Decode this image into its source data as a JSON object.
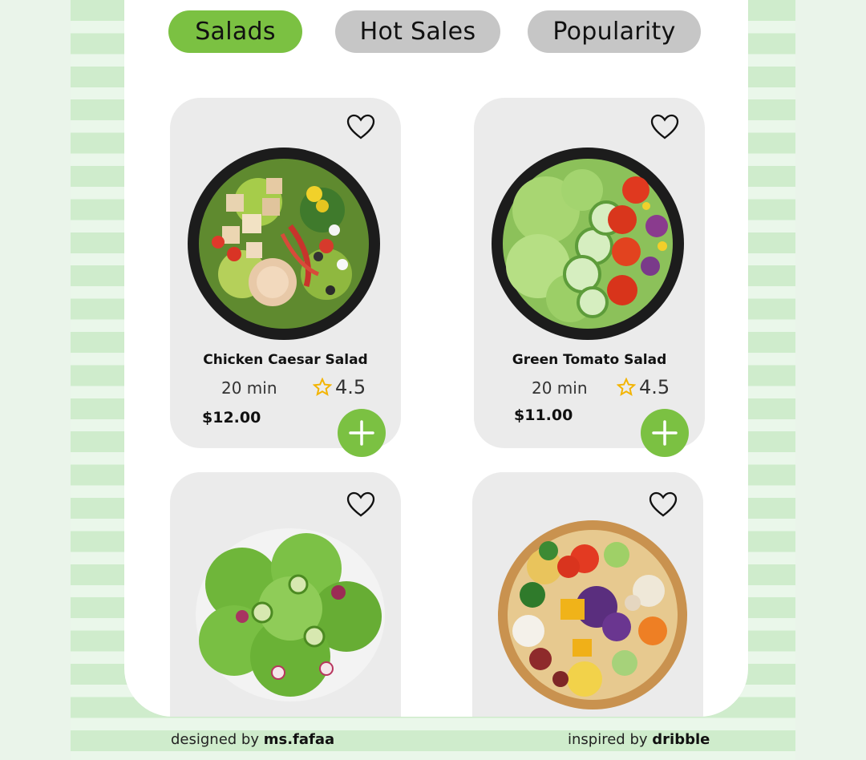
{
  "tabs": [
    {
      "label": "Salads",
      "active": true
    },
    {
      "label": "Hot Sales",
      "active": false
    },
    {
      "label": "Popularity",
      "active": false
    }
  ],
  "products": [
    {
      "name": "Chicken Caesar Salad",
      "time": "20 min",
      "rating": "4.5",
      "price": "$12.00",
      "image": "chicken-caesar-salad-bowl"
    },
    {
      "name": "Green Tomato Salad",
      "time": "20 min",
      "rating": "4.5",
      "price": "$11.00",
      "image": "green-tomato-salad-bowl"
    },
    {
      "name": "",
      "image": "green-leaf-salad-bowl"
    },
    {
      "name": "",
      "image": "vegetable-grain-bowl"
    }
  ],
  "footer": {
    "left_prefix": "designed by",
    "left_name": "ms.fafaa",
    "right_prefix": "inspired by",
    "right_name": "dribble"
  },
  "colors": {
    "accent": "#7bc142",
    "card": "#ebebeb",
    "tab_inactive": "#c6c6c6",
    "star": "#f3b400"
  }
}
